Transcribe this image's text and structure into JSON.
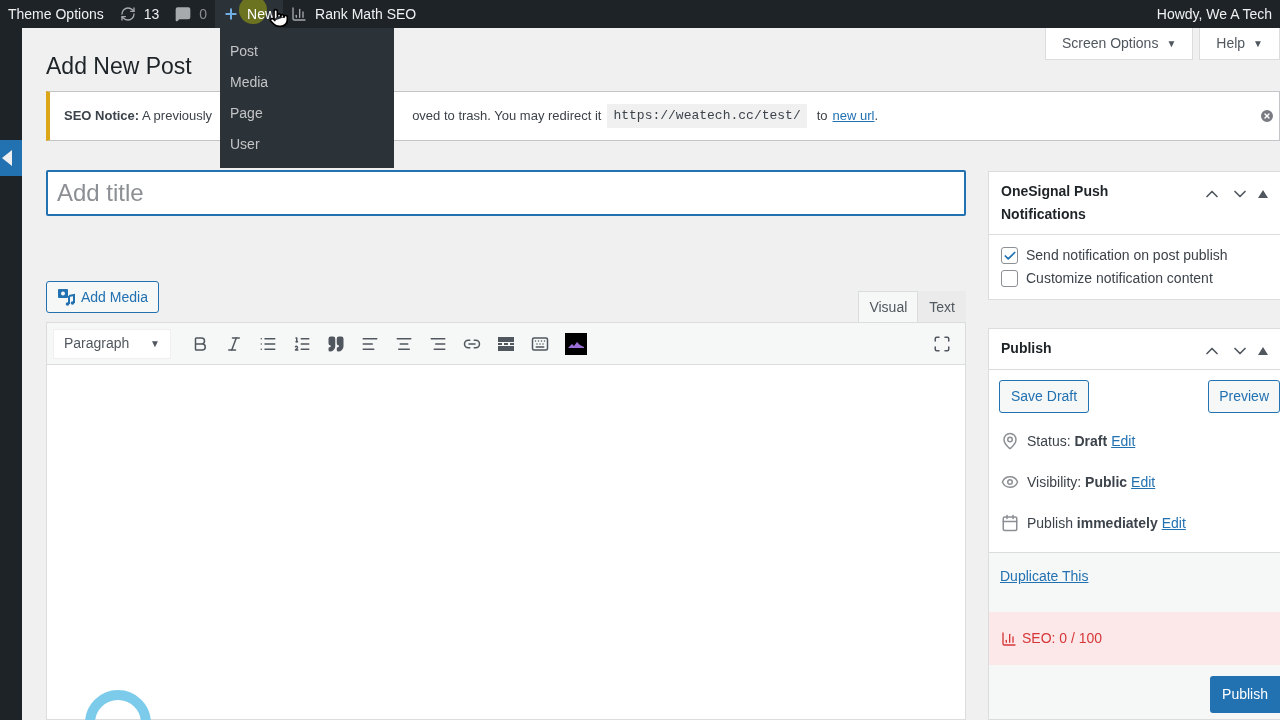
{
  "admin_bar": {
    "items": [
      {
        "kind": "text",
        "label": "Theme Options"
      },
      {
        "kind": "updates",
        "label": "13"
      },
      {
        "kind": "comments",
        "label": "0"
      },
      {
        "kind": "new",
        "label": "New"
      },
      {
        "kind": "rankmath",
        "label": "Rank Math SEO"
      }
    ],
    "greeting": "Howdy, We A Tech"
  },
  "new_menu": {
    "items": [
      "Post",
      "Media",
      "Page",
      "User"
    ]
  },
  "screen_options": "Screen Options",
  "screen_options_caret": "▼",
  "help": "Help",
  "help_caret": "▼",
  "page_title": "Add New Post",
  "notice": {
    "lead": "SEO Notice:",
    "text_before": "A previously",
    "text_after": "oved to trash. You may redirect it",
    "code": "https://weatech.cc/test/",
    "to": "to",
    "link": "new url",
    "end": "."
  },
  "title_field": {
    "placeholder": "Add title"
  },
  "add_media": "Add Media",
  "editor_tabs": [
    {
      "label": "Visual",
      "selected": true
    },
    {
      "label": "Text",
      "selected": false
    }
  ],
  "format_select": "Paragraph",
  "format_caret": "▼",
  "toolbar": [
    {
      "kind": "bold"
    },
    {
      "kind": "italic"
    },
    {
      "kind": "bullets"
    },
    {
      "kind": "numbers"
    },
    {
      "kind": "quote"
    },
    {
      "kind": "align-left"
    },
    {
      "kind": "align-center"
    },
    {
      "kind": "align-right"
    },
    {
      "kind": "link"
    },
    {
      "kind": "more"
    },
    {
      "kind": "toolbar-toggle"
    },
    {
      "kind": "image"
    }
  ],
  "onesignal": {
    "title": "OneSignal Push Notifications",
    "options": [
      {
        "label": "Send notification on post publish",
        "checked": true
      },
      {
        "label": "Customize notification content",
        "checked": false
      }
    ]
  },
  "publish": {
    "title": "Publish",
    "save_draft": "Save Draft",
    "preview": "Preview",
    "meta": [
      {
        "kind": "pin",
        "text": "Status: **Draft**",
        "link": "Edit"
      },
      {
        "kind": "eye",
        "text": "Visibility: **Public**",
        "link": "Edit"
      },
      {
        "kind": "calendar",
        "text": "Publish **immediately**",
        "link": "Edit"
      }
    ],
    "duplicate": "Duplicate This",
    "seo": "SEO: 0 / 100",
    "button": "Publish"
  }
}
